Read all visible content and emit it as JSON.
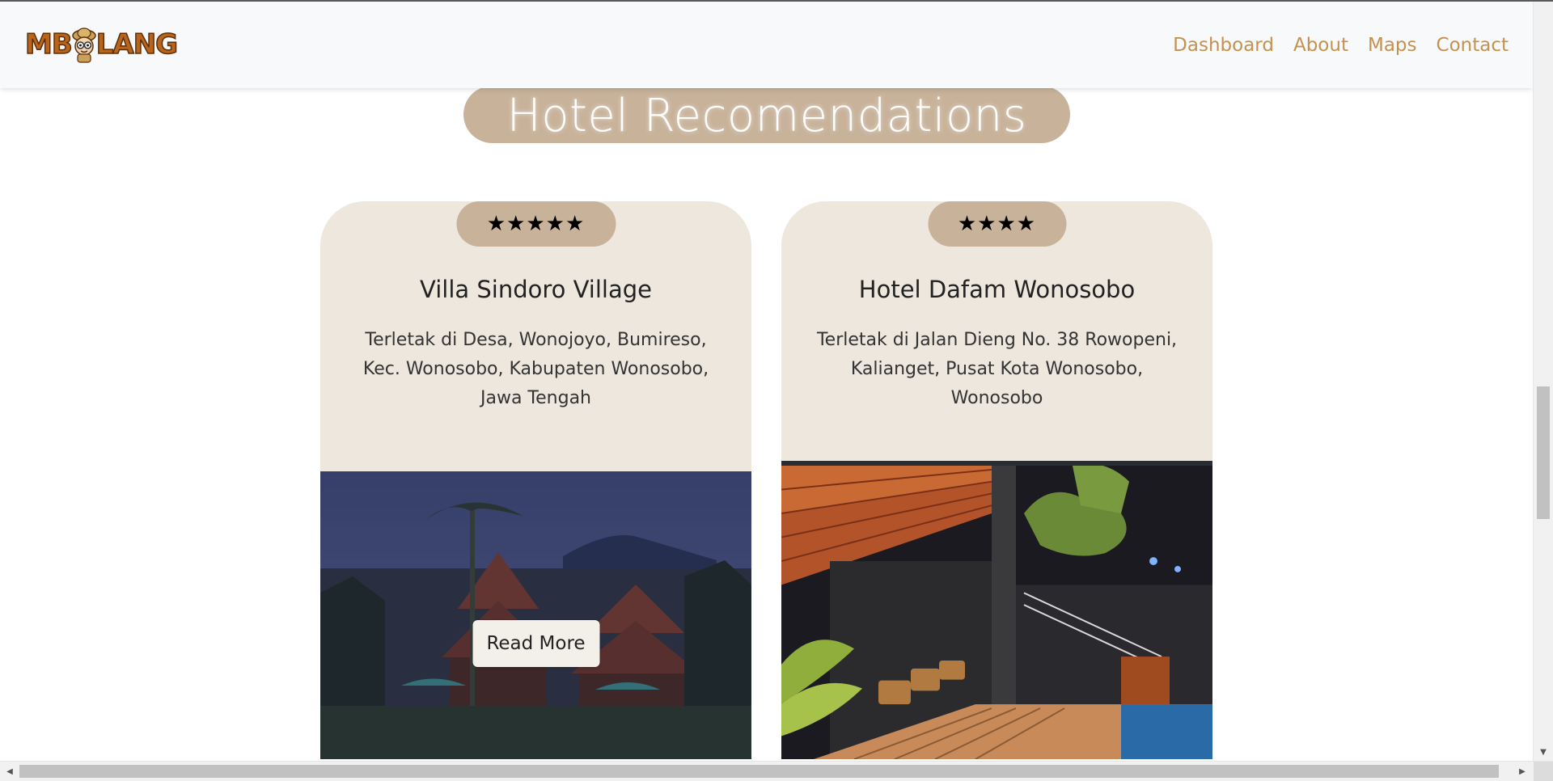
{
  "navbar": {
    "logo_text_left": "MB",
    "logo_text_right": "LANG",
    "links": [
      "Dashboard",
      "About",
      "Maps",
      "Contact"
    ],
    "link_color": "#c4914f"
  },
  "section": {
    "heading": "Hotel Recomendations"
  },
  "hotels": [
    {
      "stars": "★★★★★",
      "name": "Villa Sindoro Village",
      "description": "Terletak di Desa, Wonojoyo, Bumireso, Kec. Wonosobo, Kabupaten Wonosobo, Jawa Tengah",
      "button_label": "Read More"
    },
    {
      "stars": "★★★★",
      "name": "Hotel Dafam Wonosobo",
      "description": "Terletak di Jalan Dieng No. 38 Rowopeni, Kalianget, Pusat Kota Wonosobo, Wonosobo"
    }
  ],
  "colors": {
    "accent_tan": "#c8b29a",
    "card_bg": "#ede7dd",
    "navbar_bg": "#f8f9fa"
  },
  "icons": {
    "scroll_up": "▲",
    "scroll_down": "▼",
    "scroll_left": "◀",
    "scroll_right": "▶"
  }
}
